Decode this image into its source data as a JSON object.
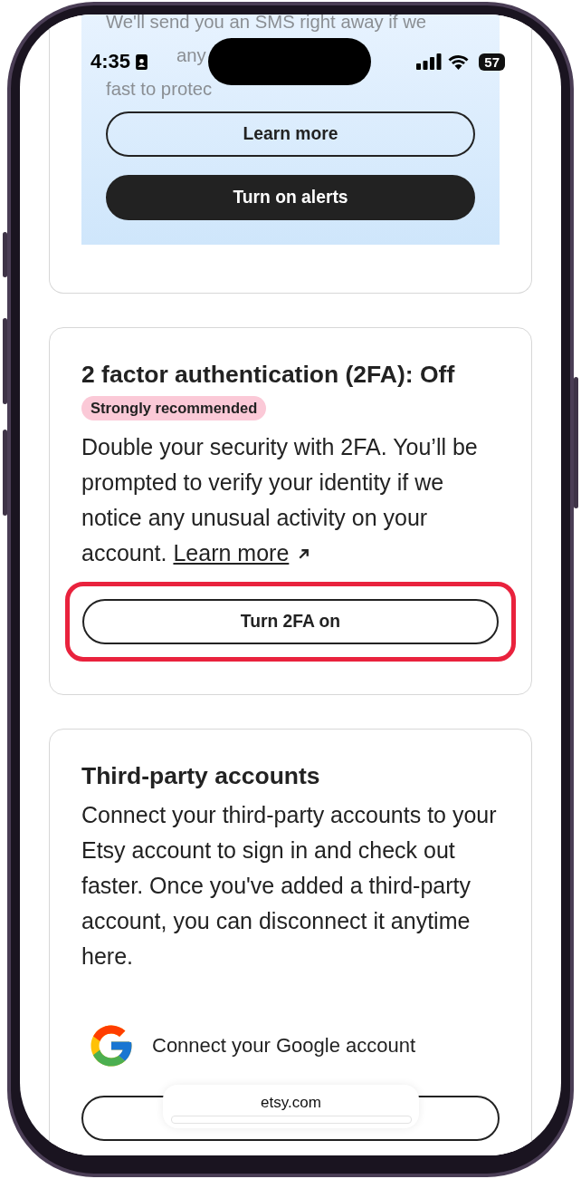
{
  "status_bar": {
    "time": "4:35",
    "battery": "57"
  },
  "alerts_card": {
    "text_fragments": [
      {
        "text": "We'll send you an SMS right away if we",
        "kind": "line"
      },
      {
        "text": "any",
        "kind": "start"
      },
      {
        "text": "fast to protec",
        "kind": "line"
      }
    ],
    "buttons": [
      {
        "label": "Learn more",
        "kind": "outline"
      },
      {
        "label": "Turn on alerts",
        "kind": "filled"
      }
    ]
  },
  "twofa_card": {
    "title": "2 factor authentication (2FA): Off",
    "badge": "Strongly recommended",
    "body": "Double your security with 2FA. You’ll be prompted to verify your identity if we notice any unusual activity on your account.",
    "link": "Learn more",
    "button": {
      "label": "Turn 2FA on",
      "highlighted": true
    }
  },
  "third_party_card": {
    "title": "Third-party accounts",
    "body": "Connect your third-party accounts to your Etsy account to sign in and check out faster. Once you've added a third-party account, you can disconnect it anytime here.",
    "google_label": "Connect your Google account"
  },
  "address_bar": {
    "url": "etsy.com"
  }
}
